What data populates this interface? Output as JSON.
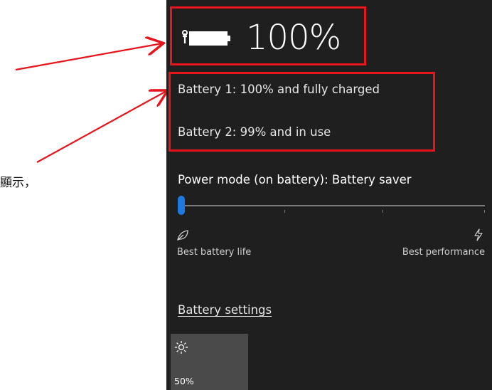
{
  "annotation": {
    "partial_text": "顯示，"
  },
  "battery": {
    "icon": "battery-full-icon",
    "percent": "100%",
    "line1": "Battery 1: 100% and fully charged",
    "line2": "Battery 2: 99% and in use"
  },
  "power_mode": {
    "label": "Power mode (on battery): Battery saver",
    "slider_level": 0,
    "left_icon": "leaf-icon",
    "left_label": "Best battery life",
    "right_icon": "lightning-icon",
    "right_label": "Best performance"
  },
  "settings_link": "Battery settings",
  "brightness_tile": {
    "icon": "sun-icon",
    "value": "50%"
  },
  "colors": {
    "flyout_bg": "#1f1f1f",
    "highlight": "#e8141c",
    "accent": "#1f7ae0",
    "tile_bg": "#4a4a4a"
  }
}
